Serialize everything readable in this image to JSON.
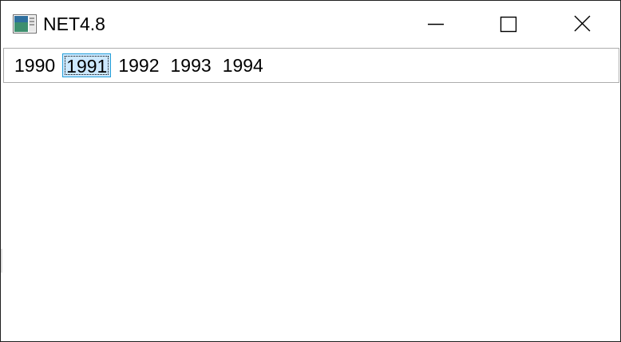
{
  "window": {
    "title": "NET4.8"
  },
  "titlebar": {
    "icons": {
      "app": "app-window-icon",
      "minimize": "minimize-icon",
      "maximize": "maximize-icon",
      "close": "close-icon"
    }
  },
  "listbox": {
    "items": [
      "1990",
      "1991",
      "1992",
      "1993",
      "1994"
    ],
    "selected_index": 1
  },
  "colors": {
    "selection_fill": "#cce8ff",
    "selection_border": "#26a0da",
    "listbox_border": "#adadad",
    "window_border": "#1f1f1f"
  }
}
